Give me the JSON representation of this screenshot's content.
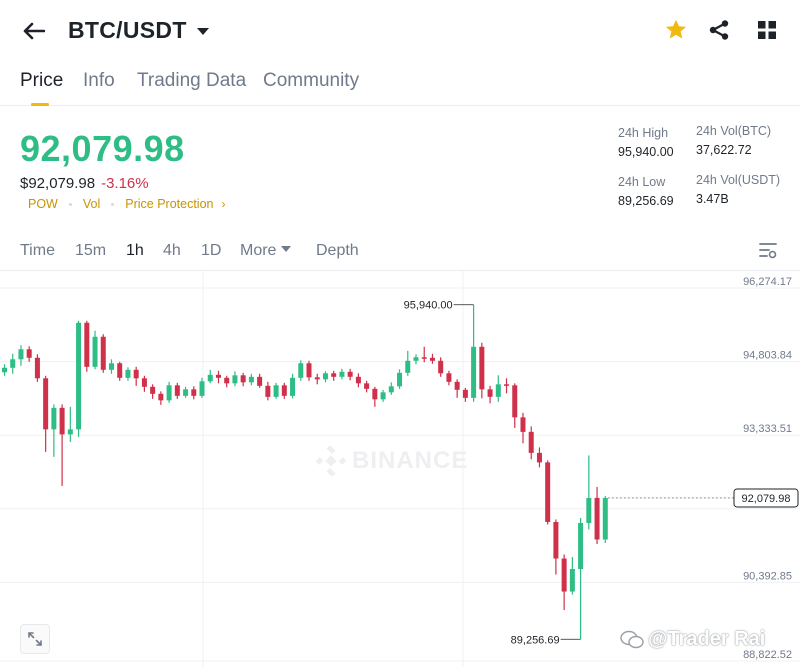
{
  "header": {
    "pair": "BTC/USDT",
    "icons": {
      "back": "arrow-left-icon",
      "favorite": "star-icon",
      "share": "share-icon",
      "grid": "grid-icon"
    },
    "favorite_color": "#F0B90B"
  },
  "tabs": [
    {
      "label": "Price",
      "active": true
    },
    {
      "label": "Info",
      "active": false
    },
    {
      "label": "Trading Data",
      "active": false
    },
    {
      "label": "Community",
      "active": false
    }
  ],
  "ticker": {
    "last_price": "92,079.98",
    "fiat_price": "$92,079.98",
    "change_pct": "-3.16%",
    "tags": [
      "POW",
      "Vol",
      "Price Protection"
    ],
    "colors": {
      "up": "#2EBD85",
      "down": "#CF304A",
      "accent": "#C99400"
    }
  },
  "stats": {
    "high_label": "24h High",
    "high_value": "95,940.00",
    "low_label": "24h Low",
    "low_value": "89,256.69",
    "vol_btc_label": "24h Vol(BTC)",
    "vol_btc_value": "37,622.72",
    "vol_usdt_label": "24h Vol(USDT)",
    "vol_usdt_value": "3.47B"
  },
  "intervals": {
    "items": [
      "Time",
      "15m",
      "1h",
      "4h",
      "1D",
      "More",
      "Depth"
    ],
    "active": "1h"
  },
  "chart": {
    "watermark": "BINANCE",
    "credit": "@Trader Rai"
  },
  "chart_data": {
    "type": "candlestick",
    "interval": "1h",
    "y_ticks": [
      "96,274.17",
      "94,803.84",
      "93,333.51",
      "90,392.85",
      "88,822.52"
    ],
    "ylim": [
      88822.52,
      96274.17
    ],
    "last_price_label": "92,079.98",
    "last_price": 92079.98,
    "high_annotation": {
      "label": "95,940.00",
      "value": 95940.0
    },
    "low_annotation": {
      "label": "89,256.69",
      "value": 89256.69
    },
    "candles": [
      [
        94590,
        94680,
        94520,
        94750
      ],
      [
        94680,
        94850,
        94560,
        94960
      ],
      [
        94850,
        95050,
        94720,
        95130
      ],
      [
        95050,
        94880,
        94800,
        95110
      ],
      [
        94880,
        94470,
        94400,
        94950
      ],
      [
        94470,
        93450,
        93000,
        94520
      ],
      [
        93450,
        93880,
        92900,
        93950
      ],
      [
        93880,
        93350,
        92320,
        93950
      ],
      [
        93350,
        93450,
        93200,
        93900
      ],
      [
        93450,
        95580,
        93300,
        95620
      ],
      [
        95580,
        94700,
        94600,
        95620
      ],
      [
        94700,
        95300,
        94650,
        95420
      ],
      [
        95300,
        94640,
        94580,
        95350
      ],
      [
        94640,
        94770,
        94560,
        94850
      ],
      [
        94770,
        94480,
        94420,
        94800
      ],
      [
        94480,
        94640,
        94420,
        94690
      ],
      [
        94640,
        94470,
        94320,
        94700
      ],
      [
        94470,
        94300,
        94200,
        94520
      ],
      [
        94300,
        94160,
        94060,
        94350
      ],
      [
        94160,
        94030,
        93940,
        94210
      ],
      [
        94030,
        94330,
        93980,
        94400
      ],
      [
        94330,
        94120,
        94060,
        94380
      ],
      [
        94120,
        94250,
        94080,
        94300
      ],
      [
        94250,
        94120,
        94050,
        94310
      ],
      [
        94120,
        94410,
        94080,
        94480
      ],
      [
        94410,
        94540,
        94370,
        94640
      ],
      [
        94540,
        94480,
        94370,
        94620
      ],
      [
        94480,
        94370,
        94290,
        94520
      ],
      [
        94370,
        94530,
        94310,
        94610
      ],
      [
        94530,
        94390,
        94310,
        94580
      ],
      [
        94390,
        94500,
        94330,
        94560
      ],
      [
        94500,
        94320,
        94280,
        94560
      ],
      [
        94320,
        94100,
        94030,
        94400
      ],
      [
        94100,
        94330,
        94060,
        94380
      ],
      [
        94330,
        94120,
        94060,
        94380
      ],
      [
        94120,
        94480,
        94070,
        94560
      ],
      [
        94480,
        94770,
        94420,
        94830
      ],
      [
        94770,
        94490,
        94420,
        94820
      ],
      [
        94490,
        94450,
        94350,
        94560
      ],
      [
        94450,
        94570,
        94390,
        94610
      ],
      [
        94570,
        94500,
        94420,
        94620
      ],
      [
        94500,
        94600,
        94450,
        94660
      ],
      [
        94600,
        94500,
        94430,
        94660
      ],
      [
        94500,
        94370,
        94290,
        94570
      ],
      [
        94370,
        94260,
        94190,
        94420
      ],
      [
        94260,
        94050,
        93900,
        94300
      ],
      [
        94050,
        94190,
        94000,
        94240
      ],
      [
        94190,
        94310,
        94140,
        94390
      ],
      [
        94310,
        94580,
        94260,
        94650
      ],
      [
        94580,
        94820,
        94520,
        95020
      ],
      [
        94820,
        94890,
        94750,
        94950
      ],
      [
        94890,
        94880,
        94790,
        95100
      ],
      [
        94880,
        94820,
        94760,
        94960
      ],
      [
        94820,
        94570,
        94500,
        94890
      ],
      [
        94570,
        94400,
        94330,
        94620
      ],
      [
        94400,
        94240,
        94080,
        94450
      ],
      [
        94240,
        94080,
        94000,
        94280
      ],
      [
        94080,
        95100,
        94000,
        95940
      ],
      [
        95100,
        94250,
        94070,
        95180
      ],
      [
        94250,
        94100,
        93970,
        94320
      ],
      [
        94100,
        94350,
        94000,
        94530
      ],
      [
        94350,
        94330,
        94170,
        94470
      ],
      [
        94330,
        93690,
        93480,
        94370
      ],
      [
        93690,
        93400,
        93170,
        93780
      ],
      [
        93400,
        92980,
        92850,
        93510
      ],
      [
        92980,
        92790,
        92690,
        93090
      ],
      [
        92790,
        91600,
        91550,
        92830
      ],
      [
        91600,
        90870,
        90550,
        91650
      ],
      [
        90870,
        90210,
        89840,
        90950
      ],
      [
        90210,
        90660,
        90150,
        90900
      ],
      [
        90660,
        91580,
        89256.69,
        91680
      ],
      [
        91580,
        92080,
        91450,
        92930
      ],
      [
        92080,
        91250,
        91160,
        92300
      ],
      [
        91250,
        92080,
        91180,
        92120
      ]
    ]
  }
}
